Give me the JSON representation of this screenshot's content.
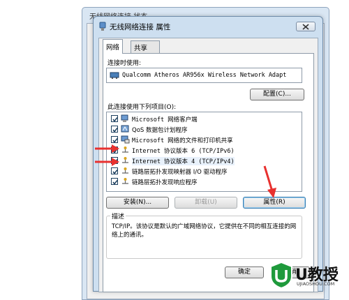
{
  "background_window": {
    "title": "无线网络连接 状态"
  },
  "dialog": {
    "title": "无线网络连接 属性",
    "tabs": [
      {
        "label": "网络"
      },
      {
        "label": "共享"
      }
    ],
    "connect_using_label": "连接时使用:",
    "adapter_name": "Qualcomm Atheros AR956x Wireless Network Adapt",
    "configure_label": "配置(C)...",
    "items_label": "此连接使用下列项目(O):",
    "items": [
      {
        "label": "Microsoft 网络客户端",
        "checked": true,
        "icon": "network-client-icon"
      },
      {
        "label": "QoS 数据包计划程序",
        "checked": true,
        "icon": "qos-icon"
      },
      {
        "label": "Microsoft 网络的文件和打印机共享",
        "checked": true,
        "icon": "file-printer-sharing-icon"
      },
      {
        "label": "Internet 协议版本 6 (TCP/IPv6)",
        "checked": true,
        "icon": "protocol-icon"
      },
      {
        "label": "Internet 协议版本 4 (TCP/IPv4)",
        "checked": true,
        "icon": "protocol-icon",
        "selected": true
      },
      {
        "label": "链路层拓扑发现映射器 I/O 驱动程序",
        "checked": true,
        "icon": "protocol-icon"
      },
      {
        "label": "链路层拓扑发现响应程序",
        "checked": true,
        "icon": "protocol-icon"
      }
    ],
    "install_label": "安装(N)...",
    "uninstall_label": "卸载(U)",
    "properties_label": "属性(R)",
    "description_title": "描述",
    "description_text": "TCP/IP。该协议是默认的广域网络协议，它提供在不同的相互连接的网络上的通讯。",
    "ok_label": "确定",
    "cancel_label": "取消"
  },
  "watermark": {
    "brand": "U教授",
    "site": "UJIAOSHOU.COM"
  },
  "colors": {
    "annotation": "#e8312f",
    "brand_green": "#1f9a3c",
    "title_bar": "#cddff0"
  }
}
